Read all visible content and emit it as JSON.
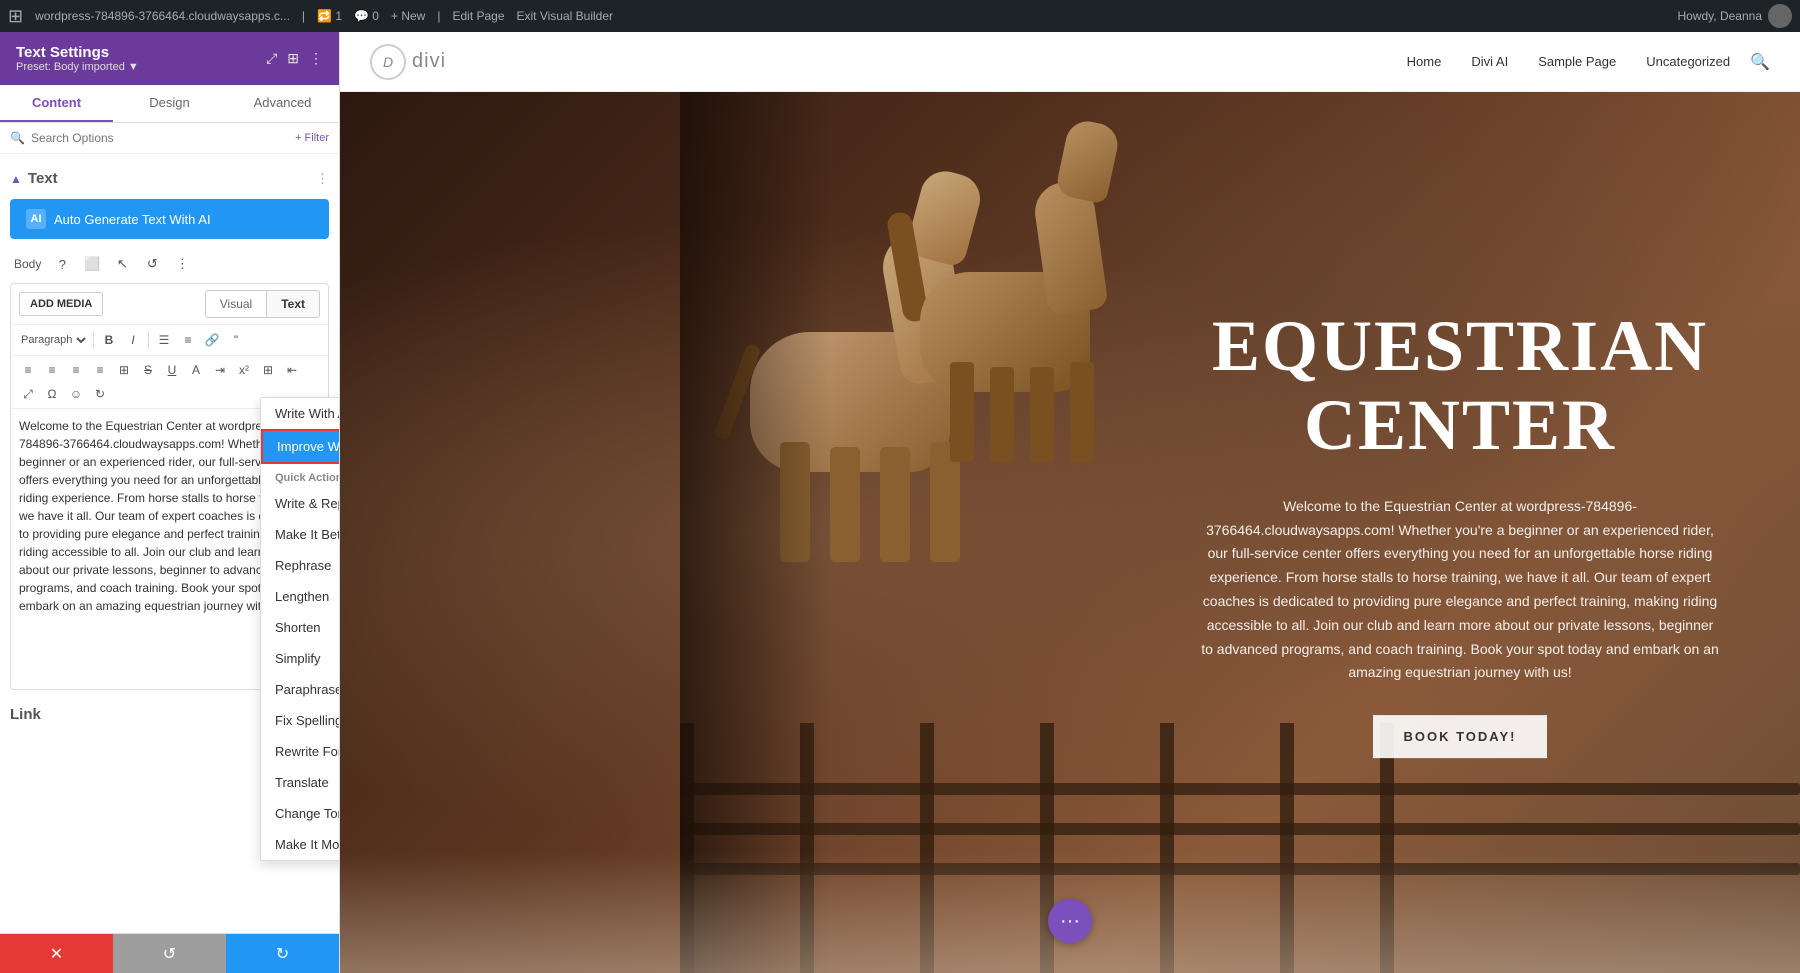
{
  "admin_bar": {
    "wp_icon": "⊞",
    "site_name": "wordpress-784896-3766464.cloudwaysapps.c...",
    "visitors": "1",
    "comments": "0",
    "new_label": "+ New",
    "edit_page": "Edit Page",
    "exit_builder": "Exit Visual Builder",
    "howdy": "Howdy, Deanna"
  },
  "panel": {
    "title": "Text Settings",
    "preset": "Preset: Body imported ▼",
    "tabs": [
      "Content",
      "Design",
      "Advanced"
    ],
    "active_tab": "Content",
    "search_placeholder": "Search Options",
    "filter_label": "+ Filter",
    "section_title": "Text",
    "ai_button_label": "Auto Generate Text With AI",
    "ai_icon": "AI",
    "toolbar": {
      "body_label": "Body",
      "question_icon": "?",
      "box_icon": "⬜",
      "cursor_icon": "↖",
      "undo_icon": "↺",
      "more_icon": "⋮"
    },
    "add_media": "ADD MEDIA",
    "editor_tabs": [
      "Visual",
      "Text"
    ],
    "formatting": {
      "paragraph": "Paragraph",
      "bold": "B",
      "italic": "I",
      "ul": "≡",
      "ol": "≡",
      "link": "🔗",
      "quote": "❝"
    },
    "text_content": "Welcome to the Equestrian Center at wordpress-784896-3766464.cloudwaysapps.com! Whether you're a beginner or an experienced rider, our full-service center offers everything you need for an unforgettable horse riding experience. From horse stalls to horse training, we have it all. Our team of expert coaches is dedicated to providing pure elegance and perfect training, making riding accessible to all. Join our club and learn more about our private lessons, beginner to advanced programs, and coach training. Book your spot today and embark on an amazing equestrian journey with us!",
    "link_section": "Link"
  },
  "ai_dropdown": {
    "write_with_ai": "Write With AI",
    "improve_with_ai": "Improve With AI",
    "quick_actions_label": "Quick Actions",
    "items": [
      {
        "label": "Write & Replace",
        "has_arrow": false
      },
      {
        "label": "Make It Better",
        "has_arrow": false
      },
      {
        "label": "Rephrase",
        "has_arrow": false
      },
      {
        "label": "Lengthen",
        "has_arrow": false
      },
      {
        "label": "Shorten",
        "has_arrow": false
      },
      {
        "label": "Simplify",
        "has_arrow": false
      },
      {
        "label": "Paraphrase",
        "has_arrow": false
      },
      {
        "label": "Fix Spelling & Grammar",
        "has_arrow": false
      },
      {
        "label": "Rewrite For",
        "has_arrow": true
      },
      {
        "label": "Translate",
        "has_arrow": true
      },
      {
        "label": "Change Tone",
        "has_arrow": true
      },
      {
        "label": "Make It More",
        "has_arrow": true
      }
    ]
  },
  "bottom_bar": {
    "cancel_icon": "✕",
    "reset_icon": "↺",
    "confirm_icon": "↻"
  },
  "website": {
    "logo_d": "D",
    "logo_text": "divi",
    "nav_links": [
      "Home",
      "Divi AI",
      "Sample Page",
      "Uncategorized"
    ],
    "hero_title": "EQUESTRIAN\nCENTER",
    "hero_subtitle": "Welcome to the Equestrian Center at wordpress-784896-3766464.cloudwaysapps.com! Whether you're a beginner or an experienced rider, our full-service center offers everything you need for an unforgettable horse riding experience. From horse stalls to horse training, we have it all. Our team of expert coaches is dedicated to providing pure elegance and perfect training, making riding accessible to all. Join our club and learn more about our private lessons, beginner to advanced programs, and coach training. Book your spot today and embark on an amazing equestrian journey with us!",
    "book_btn": "BOOK TODAY!",
    "float_btn": "···"
  }
}
